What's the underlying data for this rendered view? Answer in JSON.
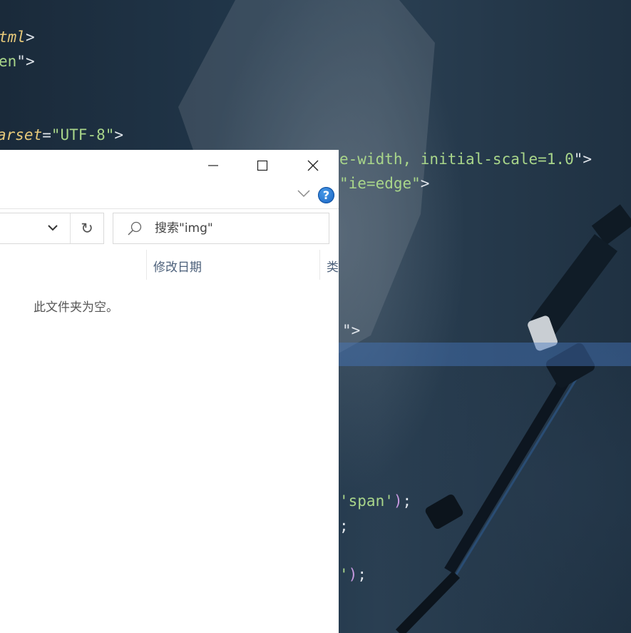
{
  "editor": {
    "lines": [
      {
        "parts": [
          {
            "t": "tml",
            "c": "attr"
          },
          {
            "t": ">",
            "c": "pun"
          }
        ]
      },
      {
        "parts": [
          {
            "t": "en",
            "c": "str"
          },
          {
            "t": "\">",
            "c": "pun"
          }
        ]
      },
      {
        "parts": [
          {
            "t": "arset",
            "c": "attr"
          },
          {
            "t": "=",
            "c": "pun"
          },
          {
            "t": "\"UTF-8\"",
            "c": "str"
          },
          {
            "t": ">",
            "c": "pun"
          }
        ]
      },
      {
        "parts": [
          {
            "t": "e-width, initial-scale=1.0",
            "c": "str"
          },
          {
            "t": "\">",
            "c": "pun"
          }
        ]
      },
      {
        "parts": [
          {
            "t": "\"ie=edge\"",
            "c": "str"
          },
          {
            "t": ">",
            "c": "pun"
          }
        ]
      },
      {
        "parts": [
          {
            "t": "\">",
            "c": "pun"
          }
        ]
      },
      {
        "parts": [
          {
            "t": "'span'",
            "c": "str"
          },
          {
            "t": ")",
            "c": "paren"
          },
          {
            "t": ";",
            "c": "pun"
          }
        ]
      },
      {
        "parts": [
          {
            "t": ";",
            "c": "pun"
          }
        ]
      },
      {
        "parts": [
          {
            "t": "'",
            "c": "str"
          },
          {
            "t": ")",
            "c": "paren"
          },
          {
            "t": ";",
            "c": "pun"
          }
        ]
      }
    ]
  },
  "explorer": {
    "search": {
      "placeholder": "搜索\"img\""
    },
    "refresh_glyph": "↻",
    "help_glyph": "?",
    "columns": [
      "修改日期",
      "类"
    ],
    "empty_message": "此文件夹为空。"
  },
  "icons": {
    "minimize": "minimize-icon",
    "maximize": "maximize-icon",
    "close": "close-icon",
    "ribbon_toggle": "chevron-down-icon",
    "help": "help-icon",
    "dropdown": "chevron-down-icon",
    "refresh": "refresh-icon",
    "search": "search-icon"
  },
  "colors": {
    "editor_bg": "#1b2b3b",
    "line_highlight": "#3f6ea8",
    "code_string": "#a9d68a",
    "code_attribute": "#e7c97a",
    "code_paren": "#c799e0",
    "help_blue": "#1560c0",
    "window_bg": "#ffffff"
  }
}
